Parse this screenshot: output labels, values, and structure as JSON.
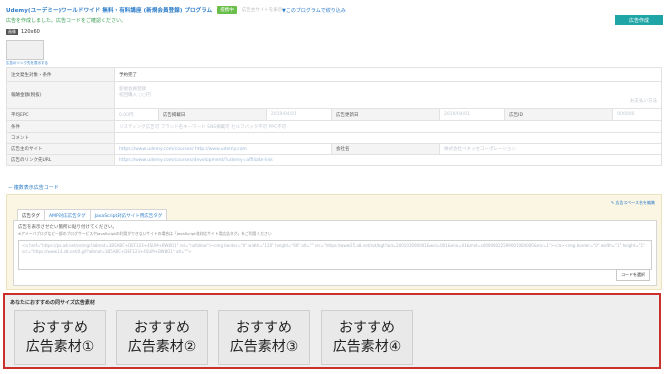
{
  "header": {
    "title": "Udemy(ユーデミー)ワールドワイド 無料・有料講座 (新規会員登録) プログラム",
    "status_badge": "提携中",
    "sub_note": "広告主サイトを表示",
    "narrow_link": "▼このプログラムで絞り込み"
  },
  "messages": {
    "success": "広告を作成しました。広告コードをご確認ください。"
  },
  "toolbar": {
    "create_label": "広告作成"
  },
  "ad_size": {
    "tag": "画像",
    "size": "120x60",
    "thumb_caption": "広告のリンク先を表示する"
  },
  "info_table": {
    "approval_label": "注文発生対象・条件",
    "approval_value": "予約完了",
    "reward_label": "報酬金額(税抜)",
    "reward_value_1": "新規会員登録",
    "reward_value_2": "初回購入 ○○円",
    "reward_right": "お支払い方法",
    "rates_label": "平均EPC",
    "rates_cols": [
      "広告掲載日",
      "広告更新日",
      "広告ID"
    ],
    "rates_values": [
      "0.00円",
      "2019/04/01",
      "2019/04/01",
      "000000"
    ],
    "conditions_label": "条件",
    "conditions_value": "リスティング広告可   ブランド名キーワード   SNS掲載可   セルフバック不可   PPC不可",
    "comment_label": "コメント",
    "comment_value": "",
    "site_label": "広告主のサイト",
    "site_value": "https://www.udemy.com/courses/  http://www.udemy.com",
    "company_label": "会社名",
    "company_value": "株式会社ベネッセコーポレーション",
    "link_label": "広告のリンク先URL",
    "link_value": "https://www.udemy.com/courses/development/?udemy=affiliate-link"
  },
  "collapse_link": "− 複数表示広告コード",
  "code_panel": {
    "edit_link": "✎ 広告スペース名を編集",
    "tabs": [
      "広告タグ",
      "AMP対応広告タグ",
      "JavaScript対応サイト用広告タグ"
    ],
    "instruction": "広告を表示させたい箇所に貼り付けてください。",
    "instruction_sub": "※アメーバブログなど一部のブログサービスやJavaScriptの利用ができないサイトの場合は「JavaScript非対応サイト用広告タグ」をご利用ください",
    "code_text": "<a href=\"https://px.a8.net/svt/ejp?a8mat=3B5ABC+DEF123+4SUM+BW8O1\" rel=\"nofollow\"><img border=\"0\" width=\"120\" height=\"60\" alt=\"\" src=\"https://www25.a8.net/svt/bgt?aid=200101000001&wid=001&eno=01&mid=s00000022599001004000&mc=1\"></a><img border=\"0\" width=\"1\" height=\"1\" src=\"https://www14.a8.net/0.gif?a8mat=3B5ABC+DEF123+4SUM+BW8O1\" alt=\"\">",
    "copy_label": "コードを選択"
  },
  "recommend": {
    "heading": "あなたにおすすめの同サイズ広告素材",
    "cards": [
      {
        "line1": "おすすめ",
        "line2": "広告素材①"
      },
      {
        "line1": "おすすめ",
        "line2": "広告素材②"
      },
      {
        "line1": "おすすめ",
        "line2": "広告素材③"
      },
      {
        "line1": "おすすめ",
        "line2": "広告素材④"
      }
    ]
  },
  "colors": {
    "accent_teal": "#1fa5a5",
    "link_blue": "#2b7cc9",
    "highlight_red": "#c9302c",
    "success_green": "#3aa055"
  }
}
